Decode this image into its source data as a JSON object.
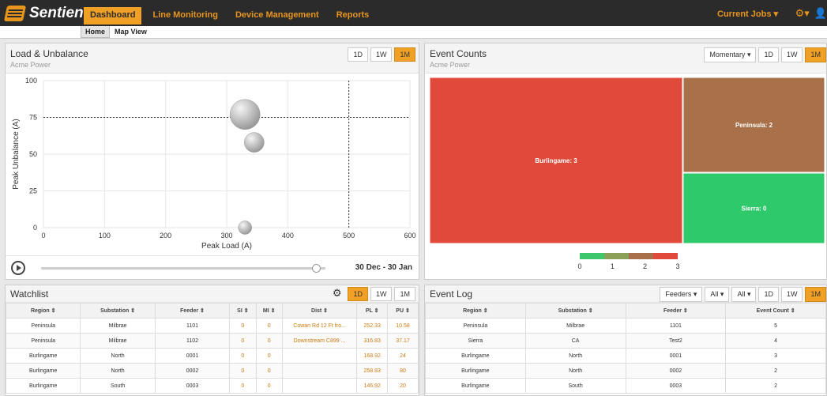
{
  "brand": {
    "name": "Sentient",
    "accent": "#f0a024",
    "dark": "#2b2b2b"
  },
  "nav": {
    "items": [
      "Dashboard",
      "Line Monitoring",
      "Device Management",
      "Reports"
    ],
    "active": "Dashboard"
  },
  "topright": {
    "jobs": "Current Jobs",
    "jobs_icon": "chevron-down-icon",
    "settings_icon": "gear-icon",
    "user_icon": "user-icon"
  },
  "subnav": {
    "items": [
      "Home",
      "Map View"
    ],
    "active": "Home"
  },
  "load": {
    "title": "Load & Unbalance",
    "subtitle": "Acme Power",
    "ranges": [
      "1D",
      "1W",
      "1M"
    ],
    "active_range": "1M",
    "date_range": "30 Dec - 30 Jan",
    "slider_fraction": 0.97,
    "play_icon": "play-icon"
  },
  "chart_data": [
    {
      "type": "scatter",
      "title": "",
      "xlabel": "Peak Load (A)",
      "ylabel": "Peak Unbalance (A)",
      "xlim": [
        0,
        600
      ],
      "ylim": [
        0,
        100
      ],
      "xticks": [
        0,
        100,
        200,
        300,
        400,
        500,
        600
      ],
      "yticks": [
        0,
        25,
        50,
        75,
        100
      ],
      "threshold_x": 500,
      "threshold_y": 75,
      "grid": true,
      "points": [
        {
          "x": 330,
          "y": 77,
          "size": 3
        },
        {
          "x": 345,
          "y": 58,
          "size": 1.3
        },
        {
          "x": 330,
          "y": 0,
          "size": 0.6
        }
      ]
    },
    {
      "type": "heatmap",
      "layout": "treemap",
      "cells": [
        {
          "label": "Burlingame: 3",
          "value": 3,
          "color": "#e04a3b"
        },
        {
          "label": "Peninsula: 2",
          "value": 2,
          "color": "#a87149"
        },
        {
          "label": "Sierra: 0",
          "value": 0,
          "color": "#2ec96a"
        }
      ],
      "scale": {
        "ticks": [
          "0",
          "1",
          "2",
          "3"
        ],
        "colors": [
          "#3ec66b",
          "#8aa157",
          "#a8704a",
          "#e04a3b"
        ]
      }
    }
  ],
  "events": {
    "title": "Event Counts",
    "subtitle": "Acme Power",
    "mode": "Momentary",
    "ranges": [
      "1D",
      "1W",
      "1M"
    ],
    "active_range": "1M"
  },
  "watchlist": {
    "title": "Watchlist",
    "ranges": [
      "1D",
      "1W",
      "1M"
    ],
    "active_range": "1D",
    "gear_icon": "gear-icon",
    "columns": [
      "Region ⇕",
      "Substation ⇕",
      "Feeder ⇕",
      "SI ⇕",
      "MI ⇕",
      "Dist ⇕",
      "PL ⇕",
      "PU ⇕"
    ],
    "rows": [
      [
        "Peninsula",
        "Milbrae",
        "1101",
        "0",
        "0",
        "Cowan Rd 12 Ft fro...",
        "252.33",
        "10.58"
      ],
      [
        "Peninsula",
        "Milbrae",
        "1102",
        "0",
        "0",
        "Downstream C899 ...",
        "316.83",
        "37.17"
      ],
      [
        "Burlingame",
        "North",
        "0001",
        "0",
        "0",
        "",
        "168.92",
        "24"
      ],
      [
        "Burlingame",
        "North",
        "0002",
        "0",
        "0",
        "",
        "258.83",
        "80"
      ],
      [
        "Burlingame",
        "South",
        "0003",
        "0",
        "0",
        "",
        "146.92",
        "20"
      ]
    ]
  },
  "eventlog": {
    "title": "Event Log",
    "filters": [
      "Feeders ▾",
      "All ▾",
      "All ▾"
    ],
    "ranges": [
      "1D",
      "1W",
      "1M"
    ],
    "active_range": "1M",
    "columns": [
      "Region ⇕",
      "Substation ⇕",
      "Feeder ⇕",
      "Event Count ⇕"
    ],
    "rows": [
      [
        "Peninsula",
        "Milbrae",
        "1101",
        "5"
      ],
      [
        "Sierra",
        "CA",
        "Test2",
        "4"
      ],
      [
        "Burlingame",
        "North",
        "0001",
        "3"
      ],
      [
        "Burlingame",
        "North",
        "0002",
        "2"
      ],
      [
        "Burlingame",
        "South",
        "0003",
        "2"
      ]
    ]
  }
}
